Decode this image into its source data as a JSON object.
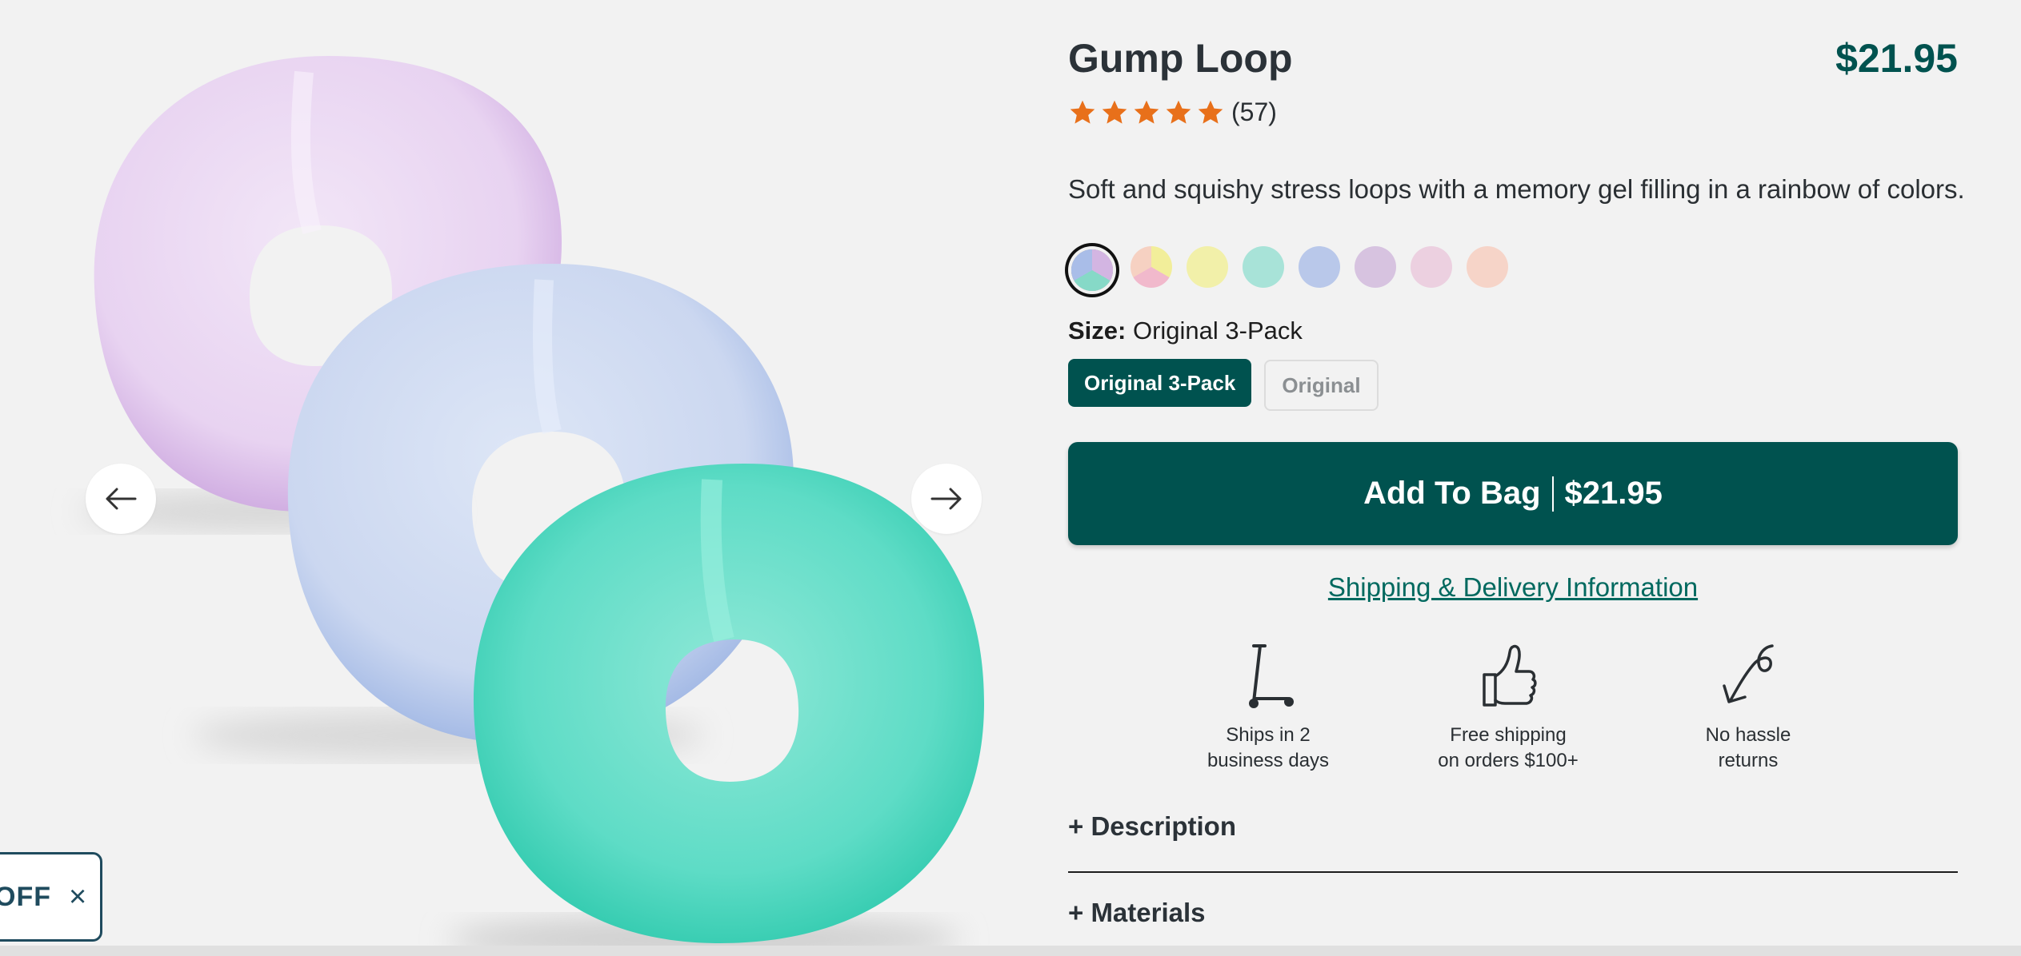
{
  "promo": {
    "text": "OFF",
    "close": "×"
  },
  "product": {
    "title": "Gump Loop",
    "price": "$21.95",
    "rating": {
      "stars": 5,
      "count": "(57)"
    },
    "description": "Soft and squishy stress loops with a memory gel filling in a rainbow of colors."
  },
  "swatches": [
    {
      "name": "multi-pastel",
      "selected": true
    },
    {
      "name": "pink-yellow"
    },
    {
      "name": "yellow",
      "color": "#f2f0a9"
    },
    {
      "name": "teal",
      "color": "#a8e3d8"
    },
    {
      "name": "blue",
      "color": "#b9c8ea"
    },
    {
      "name": "purple",
      "color": "#d7c3e0"
    },
    {
      "name": "pink",
      "color": "#ecd0e0"
    },
    {
      "name": "peach",
      "color": "#f6d4c8"
    }
  ],
  "size": {
    "label": "Size:",
    "value": "Original 3-Pack",
    "options": [
      "Original 3-Pack",
      "Original"
    ]
  },
  "add_to_bag": {
    "label": "Add To Bag",
    "price": "$21.95"
  },
  "shipping_link": "Shipping & Delivery Information",
  "features": [
    {
      "icon": "scooter-icon",
      "line1": "Ships in 2",
      "line2": "business days"
    },
    {
      "icon": "thumbs-up-icon",
      "line1": "Free shipping",
      "line2": "on orders $100+"
    },
    {
      "icon": "return-arrow-icon",
      "line1": "No hassle",
      "line2": "returns"
    }
  ],
  "accordions": [
    {
      "label": "+ Description"
    },
    {
      "label": "+ Materials"
    }
  ],
  "colors": {
    "brand": "#00524f",
    "star": "#e8701a",
    "link": "#00695f"
  }
}
